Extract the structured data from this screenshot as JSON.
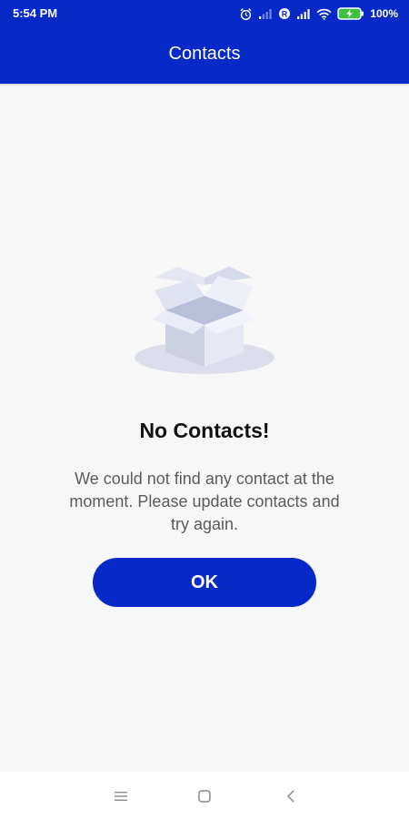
{
  "status_bar": {
    "time": "5:54 PM",
    "battery": "100%"
  },
  "app_bar": {
    "title": "Contacts"
  },
  "empty_state": {
    "title": "No Contacts!",
    "message": "We could not find any contact at the moment. Please update contacts and try again.",
    "button_label": "OK",
    "illustration": "empty-box-icon"
  },
  "nav_bar": {
    "icons": [
      "menu-icon",
      "home-icon",
      "back-icon"
    ]
  },
  "colors": {
    "primary": "#0629c8",
    "background": "#f7f7f8",
    "title_text": "#111111",
    "body_text": "#5b5b5b"
  }
}
